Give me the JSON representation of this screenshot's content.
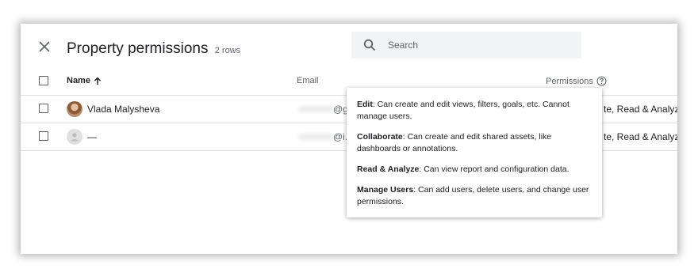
{
  "dialog": {
    "title": "Property permissions",
    "row_count": "2 rows",
    "search_placeholder": "Search"
  },
  "table": {
    "columns": {
      "name": "Name",
      "email": "Email",
      "permissions": "Permissions"
    },
    "rows": [
      {
        "name": "Vlada Malysheva",
        "email_visible": "@g",
        "permissions_visible": "te, Read & Analyze,"
      },
      {
        "name": "—",
        "email_visible": "@i.ua",
        "permissions_visible": "te, Read & Analyze,"
      }
    ]
  },
  "tooltip": {
    "items": [
      {
        "term": "Edit",
        "desc": ": Can create and edit views, filters, goals, etc. Cannot manage users."
      },
      {
        "term": "Collaborate",
        "desc": ": Can create and edit shared assets, like dashboards or annotations."
      },
      {
        "term": "Read & Analyze",
        "desc": ": Can view report and configuration data."
      },
      {
        "term": "Manage Users",
        "desc": ": Can add users, delete users, and change user permissions."
      }
    ]
  },
  "icons": {
    "close": "close-icon",
    "search": "search-icon",
    "sort": "arrow-up-icon",
    "help": "help-circle-icon",
    "avatar_placeholder": "person-icon"
  },
  "colors": {
    "text_primary": "#202124",
    "text_secondary": "#5f6368",
    "search_bg": "#f1f3f4",
    "divider": "#e0e0e0"
  }
}
